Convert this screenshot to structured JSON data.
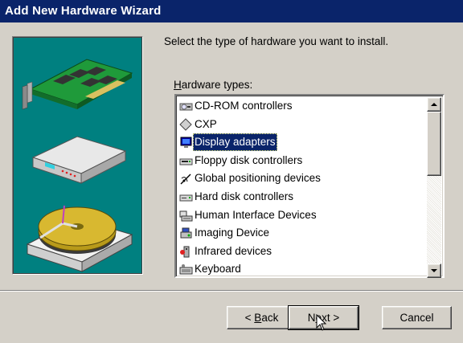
{
  "window": {
    "title": "Add New Hardware Wizard"
  },
  "instruction": "Select the type of hardware you want to install.",
  "list": {
    "label": "Hardware types:",
    "label_access_key": "H",
    "items": [
      {
        "label": "CD-ROM controllers",
        "icon": "cdrom-controller-icon"
      },
      {
        "label": "CXP",
        "icon": "cxp-diamond-icon"
      },
      {
        "label": "Display adapters",
        "icon": "display-adapter-icon",
        "selected": true
      },
      {
        "label": "Floppy disk controllers",
        "icon": "floppy-controller-icon"
      },
      {
        "label": "Global positioning devices",
        "icon": "gps-satellite-icon"
      },
      {
        "label": "Hard disk controllers",
        "icon": "hard-disk-controller-icon"
      },
      {
        "label": "Human Interface Devices",
        "icon": "hid-keyboard-icon"
      },
      {
        "label": "Imaging Device",
        "icon": "imaging-device-icon"
      },
      {
        "label": "Infrared devices",
        "icon": "infrared-icon"
      },
      {
        "label": "Keyboard",
        "icon": "keyboard-icon"
      }
    ]
  },
  "buttons": {
    "back": "< Back",
    "back_access_key": "B",
    "next": "Next >",
    "next_access_key": "e",
    "cancel": "Cancel"
  },
  "colors": {
    "titlebar": "#0a246a",
    "face": "#d4d0c8",
    "art_background": "#008080",
    "selection": "#0a246a"
  }
}
